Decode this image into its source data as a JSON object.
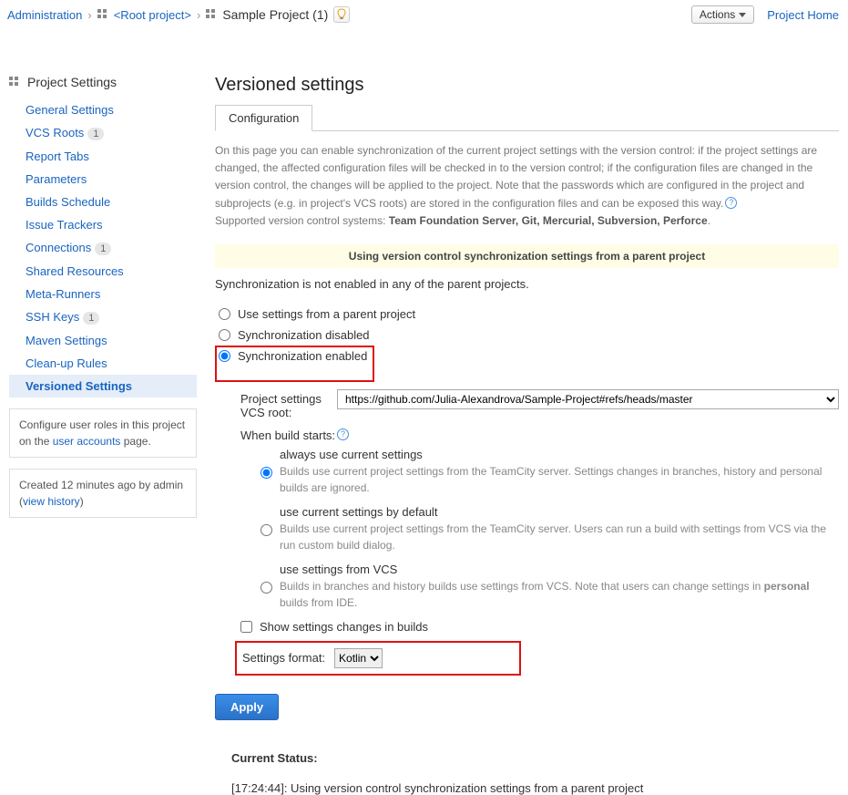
{
  "breadcrumb": {
    "admin": "Administration",
    "root": "<Root project>",
    "current": "Sample Project (1)"
  },
  "header_actions": {
    "actions": "Actions",
    "project_home": "Project Home"
  },
  "sidebar": {
    "title": "Project Settings",
    "items": [
      {
        "label": "General Settings",
        "badge": null
      },
      {
        "label": "VCS Roots",
        "badge": "1"
      },
      {
        "label": "Report Tabs",
        "badge": null
      },
      {
        "label": "Parameters",
        "badge": null
      },
      {
        "label": "Builds Schedule",
        "badge": null
      },
      {
        "label": "Issue Trackers",
        "badge": null
      },
      {
        "label": "Connections",
        "badge": "1"
      },
      {
        "label": "Shared Resources",
        "badge": null
      },
      {
        "label": "Meta-Runners",
        "badge": null
      },
      {
        "label": "SSH Keys",
        "badge": "1"
      },
      {
        "label": "Maven Settings",
        "badge": null
      },
      {
        "label": "Clean-up Rules",
        "badge": null
      },
      {
        "label": "Versioned Settings",
        "badge": null
      }
    ],
    "help1_pre": "Configure user roles in this project on the ",
    "help1_link": "user accounts",
    "help1_post": " page.",
    "created_pre": "Created 12 minutes ago by admin  (",
    "created_link": "view history",
    "created_post": ")"
  },
  "main": {
    "title": "Versioned settings",
    "tab": "Configuration",
    "desc1": "On this page you can enable synchronization of the current project settings with the version control: if the project settings are changed, the affected configuration files will be checked in to the version control; if the configuration files are changed in the version control, the changes will be applied to the project. Note that the passwords which are configured in the project and subprojects (e.g. in project's VCS roots) are stored in the configuration files and can be exposed this way.",
    "desc2_pre": "Supported version control systems: ",
    "desc2_systems": "Team Foundation Server, Git, Mercurial, Subversion, Perforce",
    "banner": "Using version control synchronization settings from a parent project",
    "sync_status": "Synchronization is not enabled in any of the parent projects.",
    "radio_parent": "Use settings from a parent project",
    "radio_disabled": "Synchronization disabled",
    "radio_enabled": "Synchronization enabled",
    "vcs_label": "Project settings VCS root:",
    "vcs_value": "https://github.com/Julia-Alexandrova/Sample-Project#refs/heads/master",
    "when_label": "When build starts:",
    "opt1_title": "always use current settings",
    "opt1_desc": "Builds use current project settings from the TeamCity server. Settings changes in branches, history and personal builds are ignored.",
    "opt2_title": "use current settings by default",
    "opt2_desc": "Builds use current project settings from the TeamCity server. Users can run a build with settings from VCS via the run custom build dialog.",
    "opt3_title": "use settings from VCS",
    "opt3_desc_pre": "Builds in branches and history builds use settings from VCS. Note that users can change settings in ",
    "opt3_desc_bold": "personal",
    "opt3_desc_post": " builds from IDE.",
    "show_changes": "Show settings changes in builds",
    "format_label": "Settings format:",
    "format_value": "Kotlin",
    "apply": "Apply",
    "status_title": "Current Status:",
    "status_line": "[17:24:44]: Using version control synchronization settings from a parent project"
  }
}
